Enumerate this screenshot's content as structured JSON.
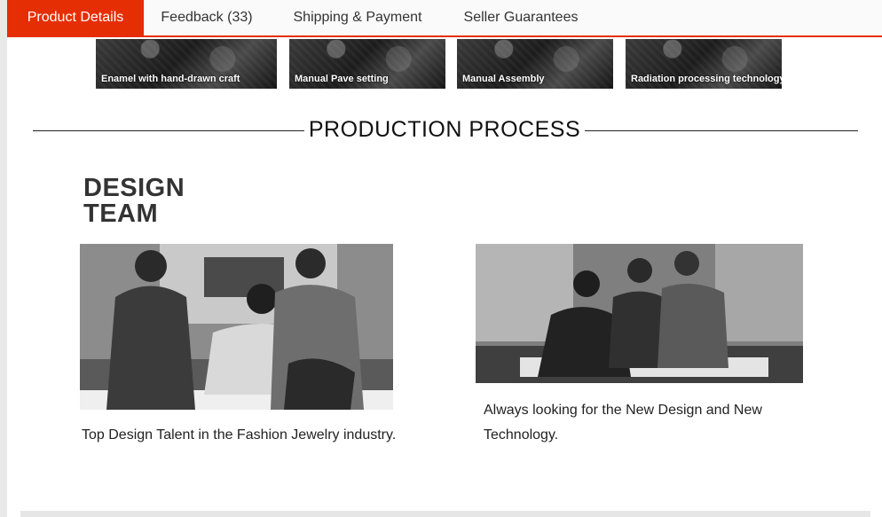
{
  "tabs": [
    {
      "label": "Product Details",
      "active": true
    },
    {
      "label": "Feedback (33)",
      "active": false
    },
    {
      "label": "Shipping & Payment",
      "active": false
    },
    {
      "label": "Seller Guarantees",
      "active": false
    }
  ],
  "crafts": [
    {
      "caption": "Enamel with hand-drawn craft"
    },
    {
      "caption": "Manual Pave setting"
    },
    {
      "caption": "Manual Assembly"
    },
    {
      "caption": "Radiation processing technology"
    }
  ],
  "section": {
    "title": "PRODUCTION PROCESS"
  },
  "design_team": {
    "line1": "DESIGN",
    "line2": "TEAM"
  },
  "photos": [
    {
      "caption": "Top Design Talent in the Fashion Jewelry industry."
    },
    {
      "caption": "Always looking for the New Design and New Technology."
    }
  ],
  "colors": {
    "accent": "#e62e04",
    "tab_bg": "#fafafa",
    "text": "#222222"
  }
}
